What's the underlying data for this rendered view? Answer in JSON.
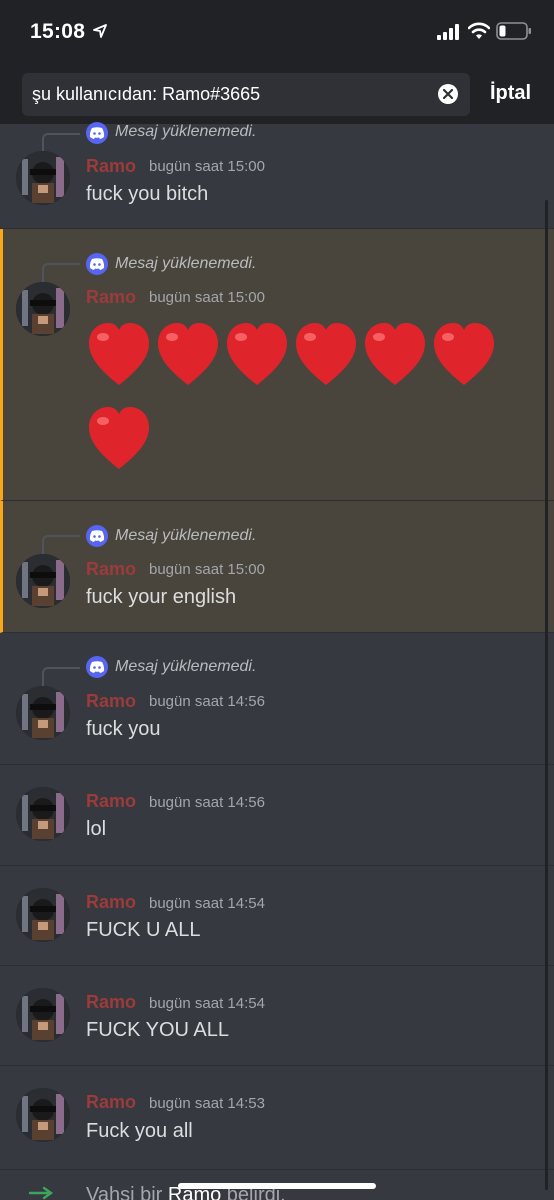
{
  "status": {
    "time": "15:08"
  },
  "search": {
    "query": "şu kullanıcıdan: Ramo#3665",
    "cancel_label": "İptal"
  },
  "messages": [
    {
      "reply": "Mesaj yüklenemedi.",
      "username": "Ramo",
      "timestamp": "bugün saat 15:00",
      "text": "fuck you bitch"
    },
    {
      "reply": "Mesaj yüklenemedi.",
      "username": "Ramo",
      "timestamp": "bugün saat 15:00",
      "emoji": [
        "heart",
        "heart",
        "heart",
        "heart",
        "heart",
        "heart",
        "heart"
      ]
    },
    {
      "reply": "Mesaj yüklenemedi.",
      "username": "Ramo",
      "timestamp": "bugün saat 15:00",
      "text": "fuck your english"
    },
    {
      "reply": "Mesaj yüklenemedi.",
      "username": "Ramo",
      "timestamp": "bugün saat 14:56",
      "text": "fuck you"
    },
    {
      "username": "Ramo",
      "timestamp": "bugün saat 14:56",
      "text": "lol"
    },
    {
      "username": "Ramo",
      "timestamp": "bugün saat 14:54",
      "text": "FUCK U ALL"
    },
    {
      "username": "Ramo",
      "timestamp": "bugün saat 14:54",
      "text": "FUCK YOU ALL"
    },
    {
      "username": "Ramo",
      "timestamp": "bugün saat 14:53",
      "text": "Fuck you all"
    }
  ],
  "system": {
    "prefix": "Vahşi bir ",
    "name": "Ramo",
    "suffix": " belirdi."
  },
  "colors": {
    "username": "#9c3b3b",
    "highlight_bar": "#faa61a",
    "discord_blurple": "#5865f2"
  }
}
